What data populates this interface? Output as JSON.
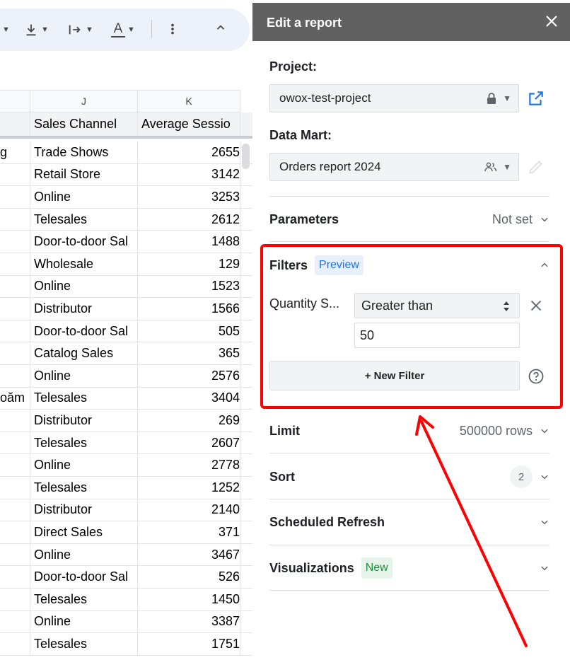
{
  "sheet": {
    "toolbar": {
      "icons": [
        "chevron-down-icon",
        "vertical-align-icon",
        "text-rotation-icon",
        "text-color-icon",
        "more-vert-icon",
        "chevron-up-icon"
      ],
      "text_color_glyph": "A"
    },
    "columns": {
      "j": "J",
      "k": "K"
    },
    "header_row": {
      "i": "",
      "j": "Sales Channel",
      "k": "Average Sessio"
    },
    "rows": [
      {
        "i": "g",
        "j": "Trade Shows",
        "k": "2655"
      },
      {
        "i": "",
        "j": "Retail Store",
        "k": "3142"
      },
      {
        "i": "",
        "j": "Online",
        "k": "3253"
      },
      {
        "i": "",
        "j": "Telesales",
        "k": "2612"
      },
      {
        "i": "",
        "j": "Door-to-door Sal",
        "k": "1488"
      },
      {
        "i": "",
        "j": "Wholesale",
        "k": "129"
      },
      {
        "i": "",
        "j": "Online",
        "k": "1523"
      },
      {
        "i": "",
        "j": "Distributor",
        "k": "1566"
      },
      {
        "i": "",
        "j": "Door-to-door Sal",
        "k": "505"
      },
      {
        "i": "",
        "j": "Catalog Sales",
        "k": "365"
      },
      {
        "i": "",
        "j": "Online",
        "k": "2576"
      },
      {
        "i": "oăm",
        "j": "Telesales",
        "k": "3404"
      },
      {
        "i": "",
        "j": "Distributor",
        "k": "269"
      },
      {
        "i": "",
        "j": "Telesales",
        "k": "2607"
      },
      {
        "i": "",
        "j": "Online",
        "k": "2778"
      },
      {
        "i": "",
        "j": "Telesales",
        "k": "1252"
      },
      {
        "i": "",
        "j": "Distributor",
        "k": "2140"
      },
      {
        "i": "",
        "j": "Direct Sales",
        "k": "371"
      },
      {
        "i": "",
        "j": "Online",
        "k": "3467"
      },
      {
        "i": "",
        "j": "Door-to-door Sal",
        "k": "526"
      },
      {
        "i": "",
        "j": "Telesales",
        "k": "1450"
      },
      {
        "i": "",
        "j": "Online",
        "k": "3387"
      },
      {
        "i": "",
        "j": "Telesales",
        "k": "1751"
      }
    ]
  },
  "panel": {
    "title": "Edit a report",
    "project": {
      "label": "Project:",
      "value": "owox-test-project"
    },
    "data_mart": {
      "label": "Data Mart:",
      "value": "Orders report 2024"
    },
    "parameters": {
      "label": "Parameters",
      "value": "Not set"
    },
    "filters": {
      "label": "Filters",
      "badge": "Preview",
      "field": "Quantity S...",
      "operator": "Greater than",
      "value": "50",
      "new_filter_button": "+ New Filter"
    },
    "limit": {
      "label": "Limit",
      "value": "500000 rows"
    },
    "sort": {
      "label": "Sort",
      "count": "2"
    },
    "scheduled_refresh": {
      "label": "Scheduled Refresh"
    },
    "visualizations": {
      "label": "Visualizations",
      "badge": "New"
    }
  },
  "colors": {
    "panel_header": "#616161",
    "annotation": "#ff0000",
    "link_blue": "#1a73e8",
    "new_badge_green": "#1e8e3e"
  }
}
